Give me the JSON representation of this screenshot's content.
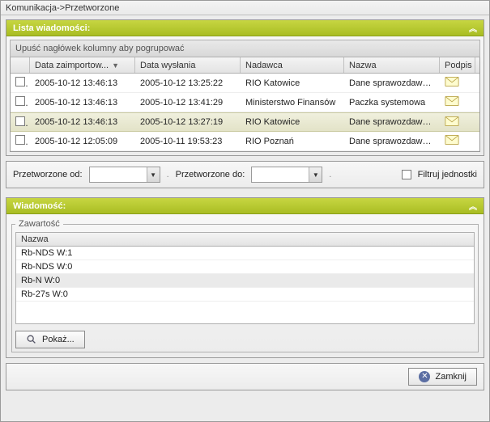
{
  "breadcrumb": "Komunikacja->Przetworzone",
  "panel_list_title": "Lista wiadomości:",
  "group_hint": "Upuść nagłówek kolumny aby pogrupować",
  "columns": {
    "imported": "Data zaimportow...",
    "sent": "Data wysłania",
    "sender": "Nadawca",
    "name": "Nazwa",
    "signature": "Podpis"
  },
  "rows": [
    {
      "imported": "2005-10-12 13:46:13",
      "sent": "2005-10-12 13:25:22",
      "sender": "RIO Katowice",
      "name": "Dane sprawozdawcze",
      "selected": false
    },
    {
      "imported": "2005-10-12 13:46:13",
      "sent": "2005-10-12 13:41:29",
      "sender": "Ministerstwo Finansów",
      "name": "Paczka systemowa",
      "selected": false
    },
    {
      "imported": "2005-10-12 13:46:13",
      "sent": "2005-10-12 13:27:19",
      "sender": "RIO Katowice",
      "name": "Dane sprawozdawcze",
      "selected": true
    },
    {
      "imported": "2005-10-12 12:05:09",
      "sent": "2005-10-11 19:53:23",
      "sender": "RIO Poznań",
      "name": "Dane sprawozdawcze",
      "selected": false
    }
  ],
  "filter": {
    "from_label": "Przetworzone od:",
    "to_label": "Przetworzone do:",
    "from_value": "",
    "to_value": "",
    "dot": ".",
    "units_label": "Filtruj jednostki",
    "units_checked": false
  },
  "panel_msg_title": "Wiadomość:",
  "contents": {
    "legend": "Zawartość",
    "header": "Nazwa",
    "items": [
      {
        "label": "Rb-NDS   W:1",
        "selected": false
      },
      {
        "label": "Rb-NDS   W:0",
        "selected": false
      },
      {
        "label": "Rb-N   W:0",
        "selected": true
      },
      {
        "label": "Rb-27s   W:0",
        "selected": false
      }
    ],
    "show_button": "Pokaż..."
  },
  "close_button": "Zamknij"
}
